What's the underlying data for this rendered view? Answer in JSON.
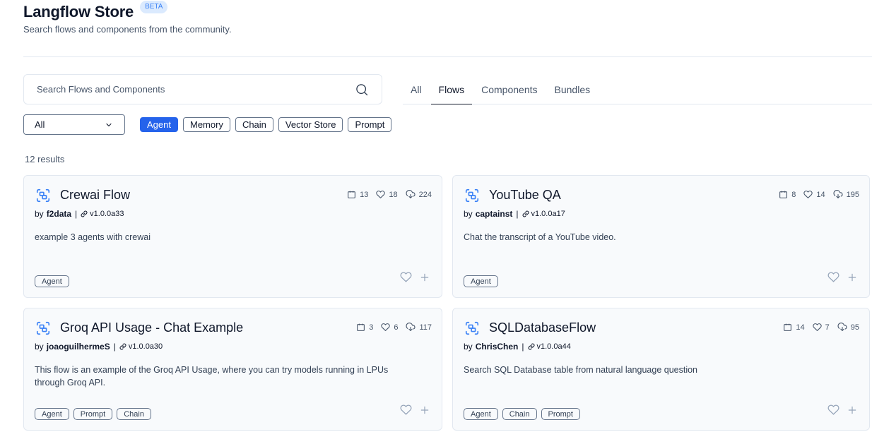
{
  "header": {
    "title": "Langflow Store",
    "badge": "BETA",
    "subtitle": "Search flows and components from the community."
  },
  "search": {
    "placeholder": "Search Flows and Components",
    "icon": "search-icon"
  },
  "tabs": [
    {
      "label": "All",
      "active": false
    },
    {
      "label": "Flows",
      "active": true
    },
    {
      "label": "Components",
      "active": false
    },
    {
      "label": "Bundles",
      "active": false
    }
  ],
  "filter": {
    "select_value": "All"
  },
  "tags": [
    {
      "label": "Agent",
      "active": true
    },
    {
      "label": "Memory",
      "active": false
    },
    {
      "label": "Chain",
      "active": false
    },
    {
      "label": "Vector Store",
      "active": false
    },
    {
      "label": "Prompt",
      "active": false
    }
  ],
  "results_label": "12 results",
  "colors": {
    "accent": "#2563eb",
    "icon_blue": "#3b82f6"
  },
  "cards": [
    {
      "title": "Crewai Flow",
      "author_prefix": "by",
      "author": "f2data",
      "separator": "|",
      "version": "v1.0.0a33",
      "description": "example 3 agents with crewai",
      "stats": {
        "components": "13",
        "likes": "18",
        "downloads": "224"
      },
      "tags": [
        "Agent"
      ]
    },
    {
      "title": "YouTube QA",
      "author_prefix": "by",
      "author": "captainst",
      "separator": "|",
      "version": "v1.0.0a17",
      "description": "Chat the transcript of a YouTube video.",
      "stats": {
        "components": "8",
        "likes": "14",
        "downloads": "195"
      },
      "tags": [
        "Agent"
      ]
    },
    {
      "title": "Groq API Usage - Chat Example",
      "author_prefix": "by",
      "author": "joaoguilhermeS",
      "separator": "|",
      "version": "v1.0.0a30",
      "description": "This flow is an example of the Groq API Usage, where you can try models running in LPUs through Groq API.",
      "stats": {
        "components": "3",
        "likes": "6",
        "downloads": "117"
      },
      "tags": [
        "Agent",
        "Prompt",
        "Chain"
      ]
    },
    {
      "title": "SQLDatabaseFlow",
      "author_prefix": "by",
      "author": "ChrisChen",
      "separator": "|",
      "version": "v1.0.0a44",
      "description": "Search SQL Database table from natural language question",
      "stats": {
        "components": "14",
        "likes": "7",
        "downloads": "95"
      },
      "tags": [
        "Agent",
        "Chain",
        "Prompt"
      ]
    }
  ]
}
